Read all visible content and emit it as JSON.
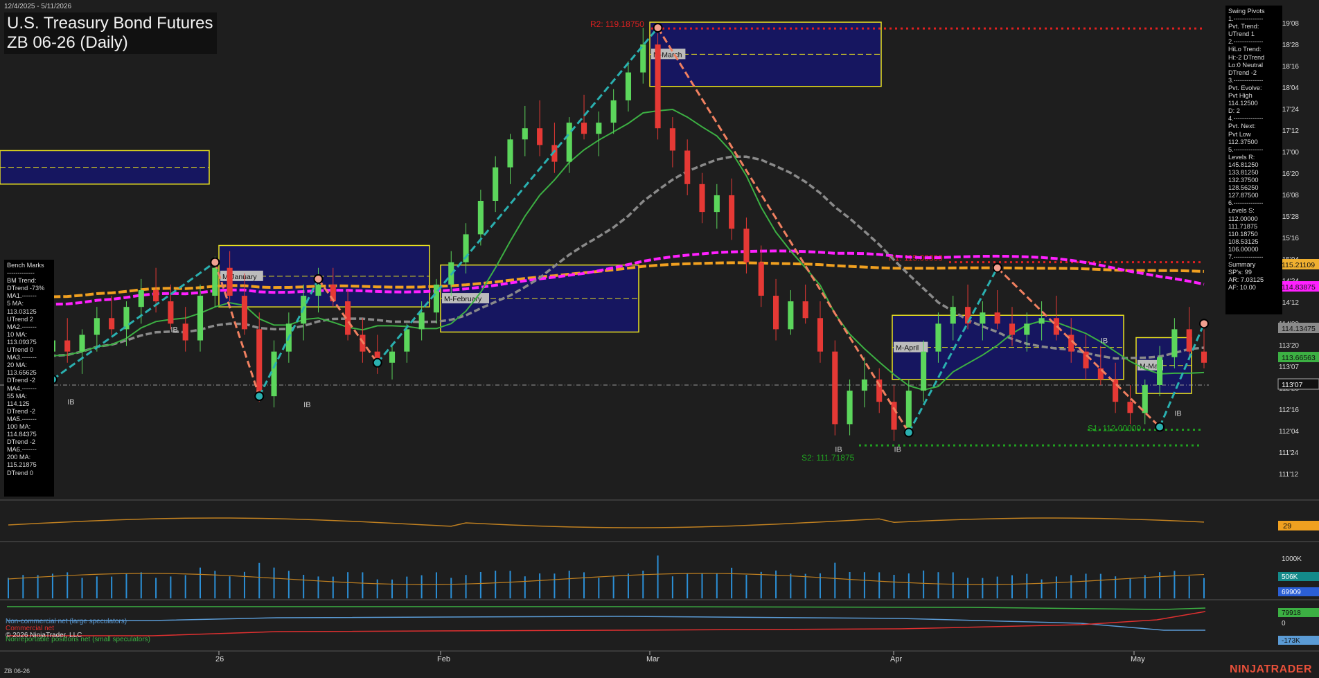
{
  "header": {
    "title_line1": "U.S. Treasury Bond Futures",
    "title_line2": "ZB 06-26 (Daily)",
    "date_range": "12/4/2025 - 5/11/2026",
    "symbol_footer": "ZB 06-26",
    "brand": "NINJATRADER",
    "copyright": "© 2026 NinjaTrader, LLC"
  },
  "bench_marks": "Bench Marks\n-------------\nBM Trend:\nDTrend -73%\nMA1.-------\n5 MA:\n113.03125\nUTrend 2\nMA2.-------\n10 MA:\n113.09375\nUTrend 0\nMA3.-------\n20 MA:\n113.65625\nDTrend -2\nMA4.-------\n55 MA:\n114.125\nDTrend -2\nMA5.-------\n100 MA:\n114.84375\nDTrend -2\nMA6.-------\n200 MA:\n115.21875\nDTrend 0",
  "swing_pivots": "Swing Pivots\n1.--------------\nPvt. Trend:\nUTrend 1\n2.--------------\nHiLo Trend:\nHi:-2 DTrend\nLo:0 Neutral\nDTrend -2\n3.--------------\nPvt. Evolve:\nPvt High\n114.12500\nD: 2\n4.--------------\nPvt. Next:\nPvt Low\n112.37500\n5.--------------\nLevels R:\n145.81250\n133.81250\n132.37500\n128.56250\n127.87500\n6.--------------\nLevels S:\n112.00000\n111.71875\n110.18750\n108.53125\n106.00000\n7.--------------\nSummary\nSP's: 99\nAR: 7.03125\nAF: 10.00",
  "legend": {
    "noncommercial": "Non-commercial net (large speculators)",
    "commercial": "Commercial net",
    "nonreportable": "Nonreportable positions net (small speculators)"
  },
  "chart_data": {
    "type": "candlestick",
    "title": "U.S. Treasury Bond Futures ZB 06-26 (Daily)",
    "y_axis_labels": [
      "119'08",
      "118'28",
      "118'16",
      "118'04",
      "117'24",
      "117'12",
      "117'00",
      "116'20",
      "116'08",
      "115'28",
      "115'16",
      "115'04",
      "114'24",
      "114'12",
      "114'00",
      "113'20",
      "113'07",
      "112'28",
      "112'16",
      "112'04",
      "111'24",
      "111'12"
    ],
    "x_axis_labels": [
      "26",
      "Feb",
      "Mar",
      "Apr",
      "May"
    ],
    "price_markers": [
      {
        "label": "115.21109",
        "color": "#f0b030"
      },
      {
        "label": "114.83875",
        "color": "#ff20ff"
      },
      {
        "label": "114.13475",
        "color": "#8a8a8a"
      },
      {
        "label": "113.66563",
        "color": "#3cb043"
      },
      {
        "label": "113'07",
        "color": "#111111"
      }
    ],
    "levels": [
      {
        "name": "R2",
        "label": "R2: 119.18750",
        "value": 119.1875,
        "color": "#e02020"
      },
      {
        "name": "R1",
        "label": "R1: 115.00000",
        "value": 115.0,
        "color": "#e02020"
      },
      {
        "name": "S1",
        "label": "S1: 112.00000",
        "value": 112.0,
        "color": "#20a020"
      },
      {
        "name": "S2",
        "label": "S2: 111.71875",
        "value": 111.71875,
        "color": "#20a020"
      }
    ],
    "month_box_labels": [
      "M-January",
      "M-February",
      "M-March",
      "M-April",
      "M-May"
    ],
    "ib_label": "IB",
    "adx_value": "29",
    "volume_labels": [
      "1000K",
      "506K",
      "69909"
    ],
    "volume_value": 506000,
    "cot_labels": [
      "79918",
      "0",
      "-173K"
    ],
    "candles": [
      [
        113.4,
        113.8,
        113.0,
        113.3
      ],
      [
        113.3,
        113.7,
        112.8,
        113.0
      ],
      [
        113.0,
        113.5,
        112.7,
        113.4
      ],
      [
        113.4,
        113.9,
        113.1,
        113.6
      ],
      [
        113.6,
        114.0,
        113.2,
        113.4
      ],
      [
        113.4,
        113.8,
        113.0,
        113.7
      ],
      [
        113.7,
        114.2,
        113.4,
        114.0
      ],
      [
        114.0,
        114.4,
        113.7,
        113.8
      ],
      [
        113.8,
        114.3,
        113.5,
        114.2
      ],
      [
        114.2,
        114.7,
        113.9,
        114.5
      ],
      [
        114.5,
        114.9,
        114.1,
        114.3
      ],
      [
        114.3,
        114.6,
        113.8,
        113.9
      ],
      [
        113.9,
        114.2,
        113.4,
        113.6
      ],
      [
        113.6,
        114.6,
        113.4,
        114.4
      ],
      [
        114.4,
        115.1,
        114.2,
        114.9
      ],
      [
        114.9,
        115.2,
        114.3,
        114.4
      ],
      [
        114.4,
        114.8,
        113.7,
        113.8
      ],
      [
        113.8,
        114.1,
        112.5,
        112.6
      ],
      [
        112.6,
        113.6,
        112.4,
        113.4
      ],
      [
        113.4,
        114.1,
        113.2,
        113.9
      ],
      [
        113.9,
        114.6,
        113.6,
        114.4
      ],
      [
        114.4,
        114.9,
        114.1,
        114.6
      ],
      [
        114.6,
        114.9,
        114.2,
        114.3
      ],
      [
        114.3,
        114.5,
        113.6,
        113.7
      ],
      [
        113.7,
        114.0,
        113.2,
        113.4
      ],
      [
        113.4,
        113.7,
        113.0,
        113.2
      ],
      [
        113.2,
        113.5,
        112.9,
        113.4
      ],
      [
        113.4,
        113.9,
        113.2,
        113.8
      ],
      [
        113.8,
        114.3,
        113.6,
        114.1
      ],
      [
        114.1,
        114.7,
        113.9,
        114.6
      ],
      [
        114.6,
        115.2,
        114.4,
        115.0
      ],
      [
        115.0,
        115.7,
        114.8,
        115.5
      ],
      [
        115.5,
        116.3,
        115.3,
        116.1
      ],
      [
        116.1,
        116.9,
        115.9,
        116.7
      ],
      [
        116.7,
        117.3,
        116.4,
        117.2
      ],
      [
        117.2,
        117.8,
        116.9,
        117.4
      ],
      [
        117.4,
        117.9,
        116.9,
        117.1
      ],
      [
        117.1,
        117.5,
        116.6,
        116.8
      ],
      [
        116.8,
        117.6,
        116.6,
        117.5
      ],
      [
        117.5,
        118.0,
        117.2,
        117.3
      ],
      [
        117.3,
        117.7,
        116.9,
        117.5
      ],
      [
        117.5,
        118.1,
        117.3,
        117.9
      ],
      [
        117.9,
        118.6,
        117.7,
        118.4
      ],
      [
        118.4,
        119.2,
        118.2,
        118.9
      ],
      [
        118.9,
        119.1,
        117.2,
        117.4
      ],
      [
        117.4,
        117.6,
        116.7,
        117.0
      ],
      [
        117.0,
        117.2,
        116.2,
        116.4
      ],
      [
        116.4,
        116.6,
        115.7,
        115.9
      ],
      [
        115.9,
        116.4,
        115.6,
        116.2
      ],
      [
        116.2,
        116.5,
        115.4,
        115.6
      ],
      [
        115.6,
        115.8,
        114.8,
        115.0
      ],
      [
        115.0,
        115.3,
        114.2,
        114.4
      ],
      [
        114.4,
        114.7,
        113.6,
        113.8
      ],
      [
        113.8,
        114.5,
        113.7,
        114.3
      ],
      [
        114.3,
        114.6,
        113.9,
        114.0
      ],
      [
        114.0,
        114.3,
        113.2,
        113.4
      ],
      [
        113.4,
        113.6,
        111.9,
        112.1
      ],
      [
        112.1,
        112.9,
        111.9,
        112.7
      ],
      [
        112.7,
        113.3,
        112.4,
        112.9
      ],
      [
        112.9,
        113.1,
        112.3,
        112.5
      ],
      [
        112.5,
        112.8,
        111.8,
        112.0
      ],
      [
        112.0,
        112.9,
        111.9,
        112.7
      ],
      [
        112.7,
        113.6,
        112.5,
        113.4
      ],
      [
        113.4,
        114.1,
        113.2,
        113.9
      ],
      [
        113.9,
        114.4,
        113.6,
        114.2
      ],
      [
        114.2,
        114.6,
        113.8,
        113.9
      ],
      [
        113.9,
        114.3,
        113.6,
        114.1
      ],
      [
        114.1,
        114.5,
        113.8,
        113.9
      ],
      [
        113.9,
        114.2,
        113.5,
        113.7
      ],
      [
        113.7,
        114.1,
        113.4,
        113.9
      ],
      [
        113.9,
        114.3,
        113.6,
        114.0
      ],
      [
        114.0,
        114.4,
        113.6,
        113.7
      ],
      [
        113.7,
        114.0,
        113.2,
        113.4
      ],
      [
        113.4,
        113.7,
        112.9,
        113.1
      ],
      [
        113.1,
        113.5,
        112.8,
        112.9
      ],
      [
        112.9,
        113.2,
        112.3,
        112.5
      ],
      [
        112.5,
        112.8,
        112.1,
        112.3
      ],
      [
        112.3,
        112.9,
        112.1,
        112.8
      ],
      [
        112.8,
        113.5,
        112.6,
        113.3
      ],
      [
        113.3,
        114.0,
        113.1,
        113.8
      ],
      [
        113.8,
        114.2,
        113.3,
        113.4
      ],
      [
        113.4,
        113.8,
        113.1,
        113.2
      ]
    ]
  }
}
